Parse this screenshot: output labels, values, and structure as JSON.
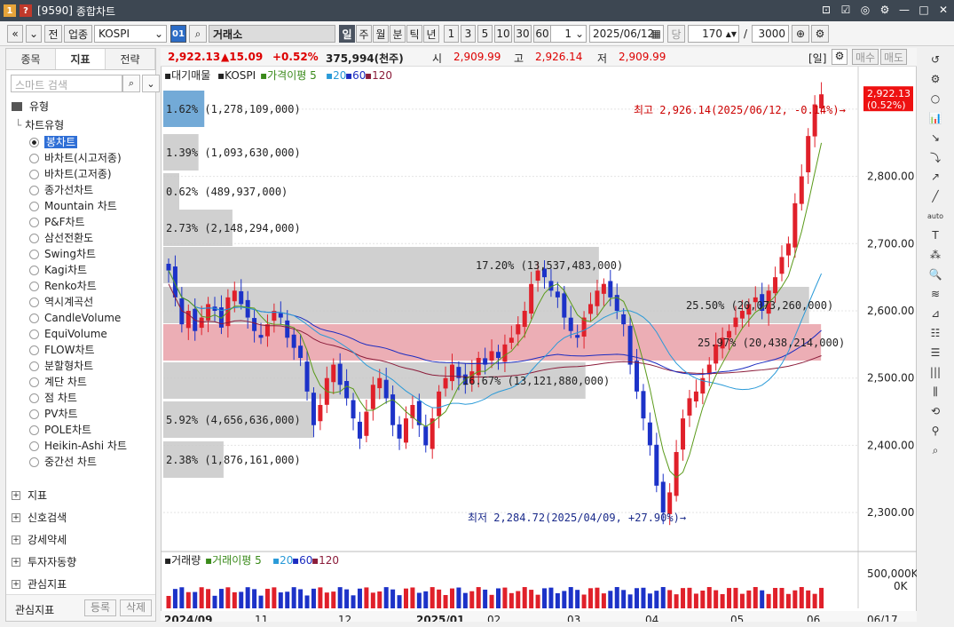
{
  "window": {
    "number": "1",
    "code": "[9590]",
    "title": "종합차트"
  },
  "toolbar": {
    "btn_prev": "«",
    "btn_down": "»",
    "btn_jeon": "전",
    "btn_sector": "업종",
    "symbol": "KOSPI",
    "symbol_code": "01",
    "market": "거래소",
    "periods": [
      "일",
      "주",
      "월",
      "분",
      "틱",
      "년"
    ],
    "active_period": "일",
    "intervals": [
      "1",
      "3",
      "5",
      "10",
      "30",
      "60"
    ],
    "spin_value": "1",
    "date": "2025/06/12",
    "dang_label": "당",
    "count": "170",
    "slash": "/",
    "max_count": "3000"
  },
  "left": {
    "tabs": [
      "종목",
      "지표",
      "전략"
    ],
    "active_tab": "지표",
    "search_placeholder": "스마트 검색",
    "type_header": "유형",
    "chart_type_header": "차트유형",
    "chart_types": [
      "봉차트",
      "바차트(시고저종)",
      "바차트(고저종)",
      "종가선차트",
      "Mountain 차트",
      "P&F차트",
      "삼선전환도",
      "Swing차트",
      "Kagi차트",
      "Renko차트",
      "역시계곡선",
      "CandleVolume",
      "EquiVolume",
      "FLOW차트",
      "분할형차트",
      "계단 차트",
      "점 차트",
      "PV차트",
      "POLE차트",
      "Heikin-Ashi 차트",
      "중간선 차트"
    ],
    "selected_type": "봉차트",
    "sections": [
      "지표",
      "신호검색",
      "강세약세",
      "투자자동향",
      "관심지표"
    ],
    "footer_label": "관심지표",
    "footer_btn1": "등록",
    "footer_btn2": "삭제"
  },
  "quote": {
    "price": "2,922.13",
    "change": "▲15.09",
    "pct": "+0.52%",
    "volume": "375,994(천주)",
    "open_label": "시",
    "open": "2,909.99",
    "high_label": "고",
    "high": "2,926.14",
    "low_label": "저",
    "low": "2,909.99",
    "period_tag": "[일]",
    "buy": "매수",
    "sell": "매도"
  },
  "legend": {
    "l1": "대기매물",
    "l2": "KOSPI",
    "l3": "가격이평 5",
    "l4": "20",
    "l5": "60",
    "l6": "120"
  },
  "vol_legend": {
    "l1": "거래량",
    "l2": "거래이평 5",
    "l3": "20",
    "l4": "60",
    "l5": "120"
  },
  "annotations": {
    "high": "최고 2,926.14(2025/06/12, -0.14%)",
    "low": "최저 2,284.72(2025/04/09, +27.90%)",
    "last_price": "2,922.13",
    "last_pct": "(0.52%)"
  },
  "volume_profile": [
    {
      "label": "1.62% (1,278,109,000)",
      "pct": 1.62
    },
    {
      "label": "1.39% (1,093,630,000)",
      "pct": 1.39
    },
    {
      "label": "0.62% (489,937,000)",
      "pct": 0.62
    },
    {
      "label": "2.73% (2,148,294,000)",
      "pct": 2.73
    },
    {
      "label": "17.20% (13,537,483,000)",
      "pct": 17.2
    },
    {
      "label": "25.50% (20,073,260,000)",
      "pct": 25.5
    },
    {
      "label": "25.97% (20,438,214,000)",
      "pct": 25.97
    },
    {
      "label": "16.67% (13,121,880,000)",
      "pct": 16.67
    },
    {
      "label": "5.92% (4,656,636,000)",
      "pct": 5.92
    },
    {
      "label": "2.38% (1,876,161,000)",
      "pct": 2.38
    }
  ],
  "price_axis": [
    "2,800.00",
    "2,700.00",
    "2,600.00",
    "2,500.00",
    "2,400.00",
    "2,300.00"
  ],
  "volume_axis": [
    "500,000K",
    "0K"
  ],
  "time_axis": [
    "2024/09",
    "11",
    "12",
    "2025/01",
    "02",
    "03",
    "04",
    "05",
    "06"
  ],
  "time_axis_right": "06/17",
  "chart_data": {
    "type": "candlestick",
    "x_start": "2024/09",
    "x_end": "2025/06/12",
    "ylim": [
      2250,
      2950
    ],
    "high": 2926.14,
    "high_date": "2025/06/12",
    "low": 2284.72,
    "low_date": "2025/04/09",
    "close": [
      2660,
      2620,
      2580,
      2600,
      2570,
      2590,
      2610,
      2600,
      2575,
      2620,
      2630,
      2610,
      2590,
      2570,
      2560,
      2580,
      2600,
      2590,
      2560,
      2545,
      2530,
      2480,
      2430,
      2460,
      2500,
      2520,
      2490,
      2470,
      2440,
      2410,
      2450,
      2490,
      2500,
      2470,
      2430,
      2410,
      2440,
      2460,
      2430,
      2400,
      2440,
      2480,
      2500,
      2520,
      2500,
      2490,
      2510,
      2530,
      2520,
      2540,
      2530,
      2550,
      2560,
      2580,
      2600,
      2640,
      2660,
      2650,
      2630,
      2620,
      2590,
      2570,
      2560,
      2590,
      2610,
      2630,
      2640,
      2620,
      2600,
      2580,
      2520,
      2480,
      2440,
      2400,
      2340,
      2300,
      2330,
      2390,
      2440,
      2470,
      2480,
      2500,
      2520,
      2550,
      2560,
      2570,
      2590,
      2600,
      2610,
      2620,
      2600,
      2630,
      2650,
      2680,
      2700,
      2760,
      2800,
      2860,
      2907,
      2922
    ]
  }
}
